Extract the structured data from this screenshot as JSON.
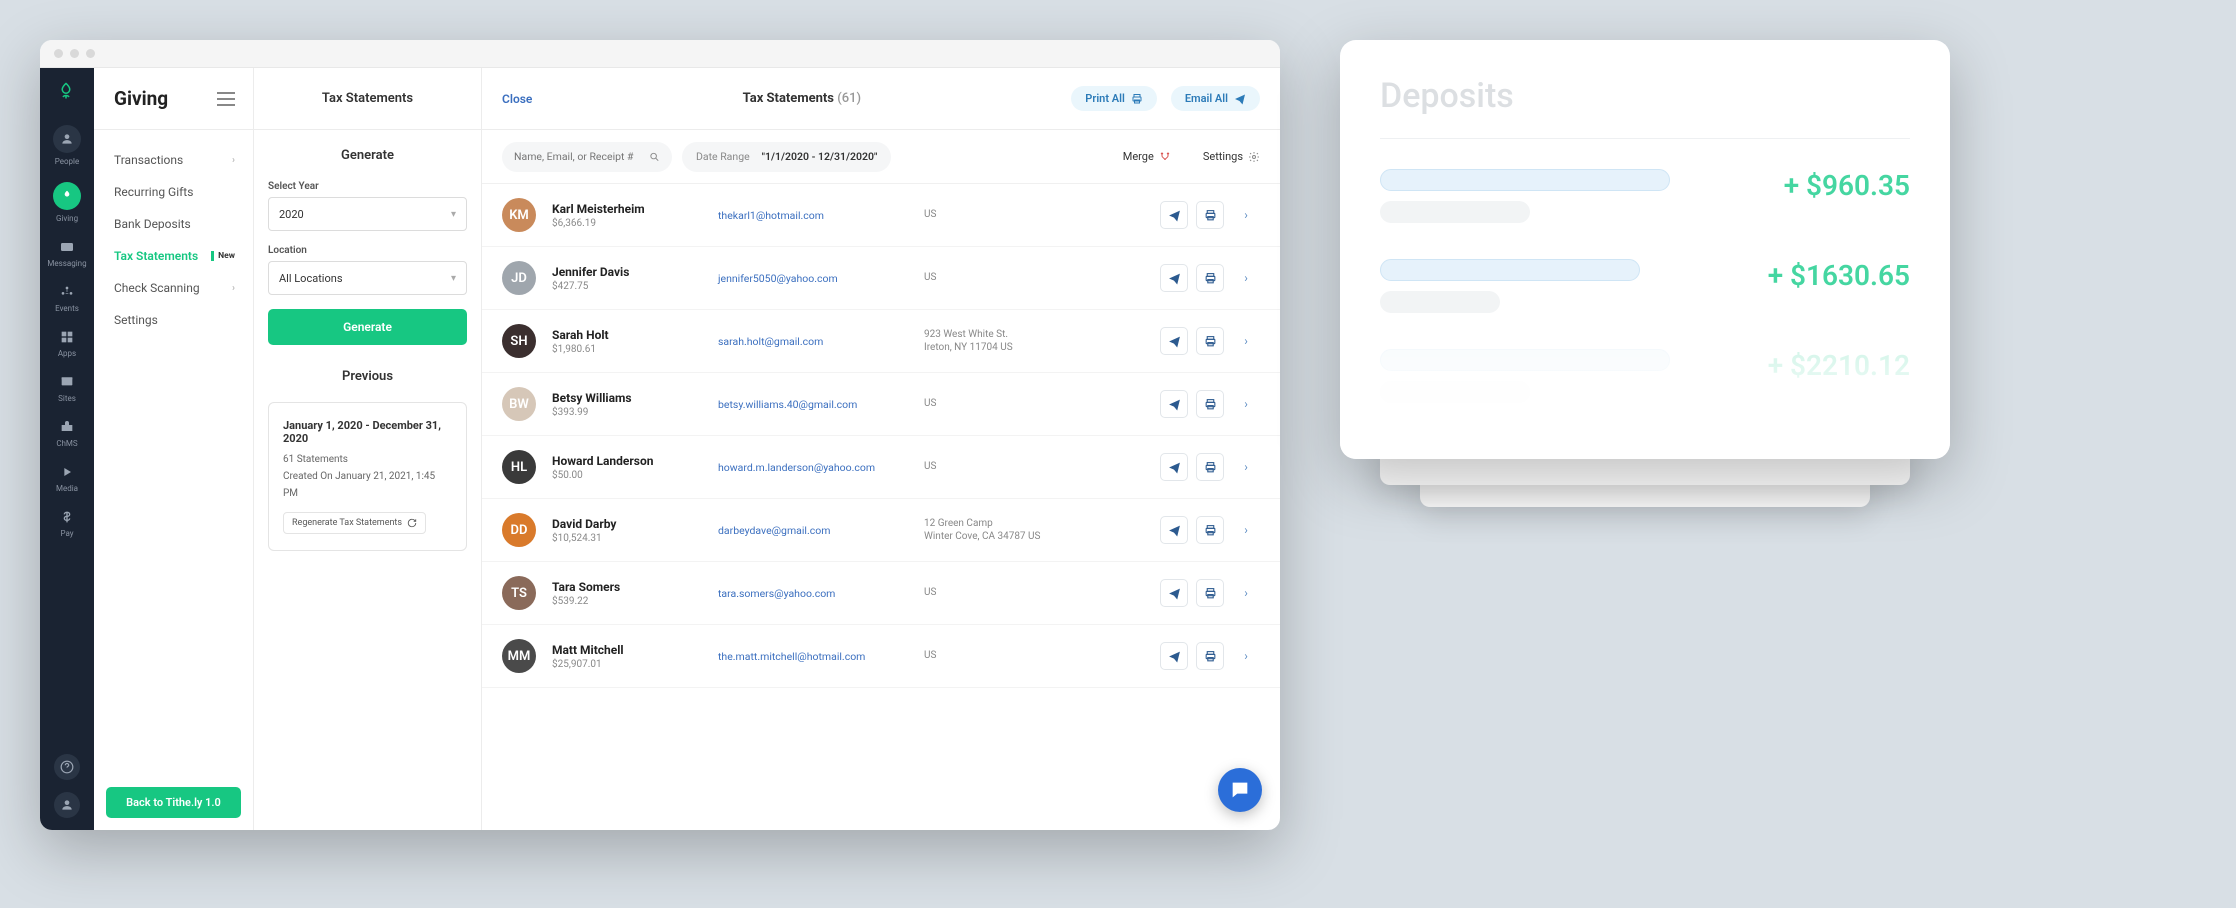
{
  "rail": {
    "items": [
      {
        "label": "People"
      },
      {
        "label": "Giving"
      },
      {
        "label": "Messaging"
      },
      {
        "label": "Events"
      },
      {
        "label": "Apps"
      },
      {
        "label": "Sites"
      },
      {
        "label": "ChMS"
      },
      {
        "label": "Media"
      },
      {
        "label": "Pay"
      }
    ]
  },
  "sidebar": {
    "title": "Giving",
    "items": [
      {
        "label": "Transactions",
        "chevron": true
      },
      {
        "label": "Recurring Gifts"
      },
      {
        "label": "Bank Deposits"
      },
      {
        "label": "Tax Statements",
        "badge": "New",
        "active": true
      },
      {
        "label": "Check Scanning",
        "chevron": true
      },
      {
        "label": "Settings"
      }
    ],
    "back_button": "Back to Tithe.ly 1.0"
  },
  "generate_panel": {
    "header": "Tax Statements",
    "section_title": "Generate",
    "year_label": "Select Year",
    "year_value": "2020",
    "location_label": "Location",
    "location_value": "All Locations",
    "generate_button": "Generate",
    "previous_title": "Previous",
    "previous": {
      "range": "January 1, 2020 - December 31, 2020",
      "count": "61 Statements",
      "created": "Created On January 21, 2021, 1:45 PM",
      "regenerate": "Regenerate Tax Statements"
    }
  },
  "main": {
    "close": "Close",
    "title": "Tax Statements",
    "count": "(61)",
    "print_all": "Print All",
    "email_all": "Email All",
    "search_placeholder": "Name, Email, or Receipt #",
    "date_range_label": "Date Range",
    "date_range_value": "\"1/1/2020 - 12/31/2020\"",
    "merge": "Merge",
    "settings": "Settings",
    "rows": [
      {
        "name": "Karl Meisterheim",
        "amount": "$6,366.19",
        "email": "thekarl1@hotmail.com",
        "address": "US",
        "avatar_bg": "#c98a5b"
      },
      {
        "name": "Jennifer Davis",
        "amount": "$427.75",
        "email": "jennifer5050@yahoo.com",
        "address": "US",
        "avatar_bg": "#9fa6ad"
      },
      {
        "name": "Sarah Holt",
        "amount": "$1,980.61",
        "email": "sarah.holt@gmail.com",
        "address": "923 West White St.\nIreton, NY 11704 US",
        "avatar_bg": "#3b2f2f"
      },
      {
        "name": "Betsy Williams",
        "amount": "$393.99",
        "email": "betsy.williams.40@gmail.com",
        "address": "US",
        "avatar_bg": "#d6c7b8"
      },
      {
        "name": "Howard Landerson",
        "amount": "$50.00",
        "email": "howard.m.landerson@yahoo.com",
        "address": "US",
        "avatar_bg": "#3a3a3a"
      },
      {
        "name": "David Darby",
        "amount": "$10,524.31",
        "email": "darbeydave@gmail.com",
        "address": "12 Green Camp\nWinter Cove, CA 34787 US",
        "avatar_bg": "#d97a2b"
      },
      {
        "name": "Tara Somers",
        "amount": "$539.22",
        "email": "tara.somers@yahoo.com",
        "address": "US",
        "avatar_bg": "#8a6a5a"
      },
      {
        "name": "Matt Mitchell",
        "amount": "$25,907.01",
        "email": "the.matt.mitchell@hotmail.com",
        "address": "US",
        "avatar_bg": "#4a4a4a"
      }
    ]
  },
  "deposits": {
    "title": "Deposits",
    "items": [
      {
        "amount": "+ $960.35",
        "bar1_w": 290,
        "bar2_w": 150
      },
      {
        "amount": "+ $1630.65",
        "bar1_w": 260,
        "bar2_w": 120
      },
      {
        "amount": "+ $2210.12",
        "bar1_w": 290,
        "bar2_w": 150,
        "faded": true
      }
    ]
  }
}
